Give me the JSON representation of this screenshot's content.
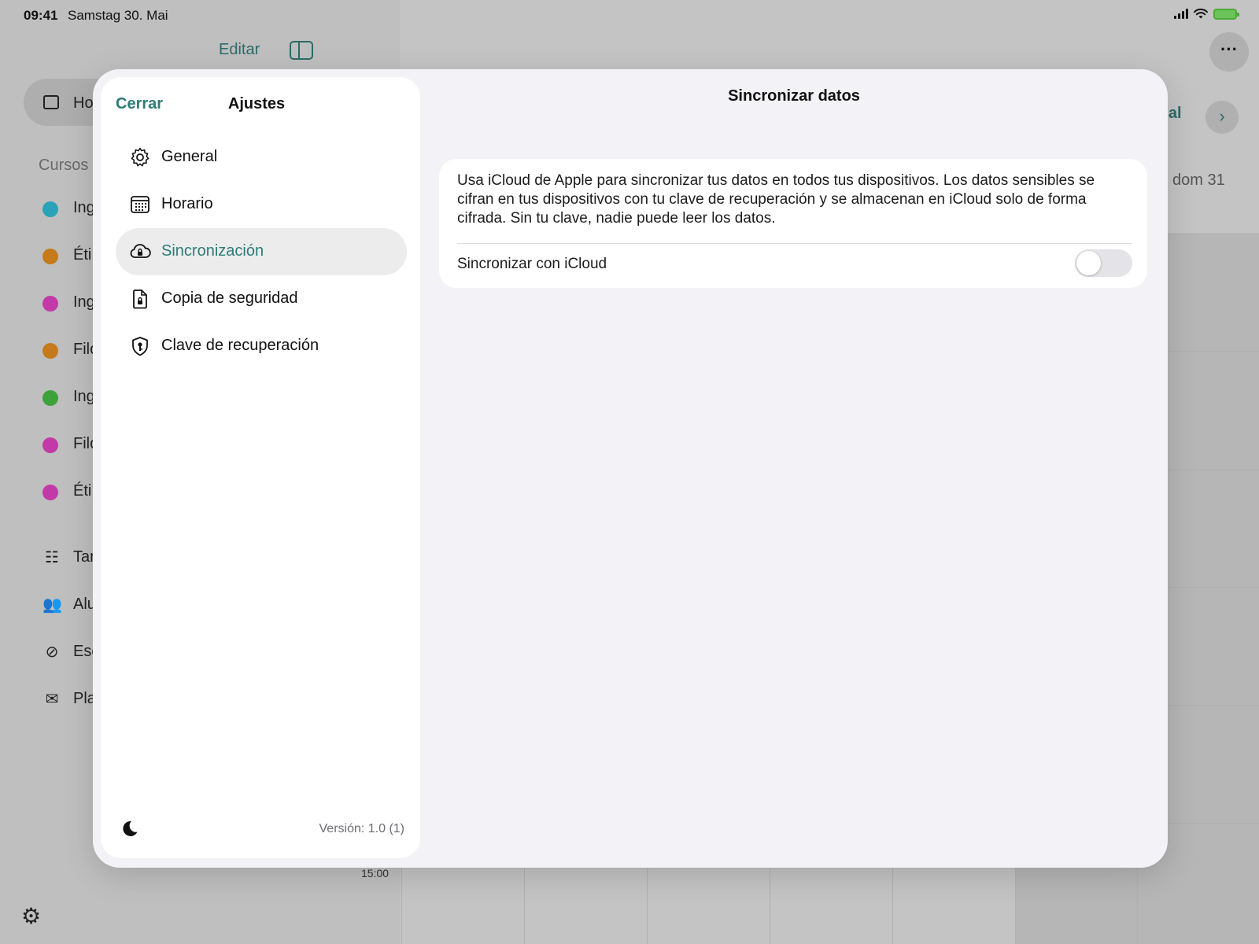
{
  "status_bar": {
    "time": "09:41",
    "date": "Samstag 30. Mai"
  },
  "background": {
    "toolbar_edit": "Editar",
    "nav_item": "Ho",
    "section_label": "Cursos",
    "courses": [
      {
        "label": "Ing",
        "color": "#2aa2b8"
      },
      {
        "label": "Éti",
        "color": "#c57a1c"
      },
      {
        "label": "Ing",
        "color": "#c23aa8"
      },
      {
        "label": "Filo",
        "color": "#c57a1c"
      },
      {
        "label": "Ing",
        "color": "#3ea23a"
      },
      {
        "label": "Filo",
        "color": "#c23aa8"
      },
      {
        "label": "Éti",
        "color": "#c23aa8"
      }
    ],
    "tools": [
      {
        "label": "Tar",
        "icon": "checklist-icon"
      },
      {
        "label": "Alu",
        "icon": "people-icon"
      },
      {
        "label": "Esc",
        "icon": "slash-circle-icon"
      },
      {
        "label": "Pla",
        "icon": "envelope-icon"
      }
    ],
    "actual_label": "tual",
    "day_label": "dom 31",
    "hour_label": "15:00"
  },
  "settings": {
    "close_label": "Cerrar",
    "title": "Ajustes",
    "menu": [
      {
        "label": "General",
        "icon": "gear-icon",
        "selected": false
      },
      {
        "label": "Horario",
        "icon": "calendar-grid-icon",
        "selected": false
      },
      {
        "label": "Sincronización",
        "icon": "cloud-lock-icon",
        "selected": true
      },
      {
        "label": "Copia de seguridad",
        "icon": "document-lock-icon",
        "selected": false
      },
      {
        "label": "Clave de recuperación",
        "icon": "shield-key-icon",
        "selected": false
      }
    ],
    "version": "Versión: 1.0 (1)",
    "accent_color": "#2b7c77"
  },
  "detail": {
    "title": "Sincronizar datos",
    "description": "Usa iCloud de Apple para sincronizar tus datos en todos tus dispositivos. Los datos sensibles se cifran en tus dispositivos con tu clave de recuperación y se almacenan en iCloud solo de forma cifrada. Sin tu clave, nadie puede leer los datos.",
    "sync_label": "Sincronizar con iCloud",
    "sync_enabled": false
  }
}
